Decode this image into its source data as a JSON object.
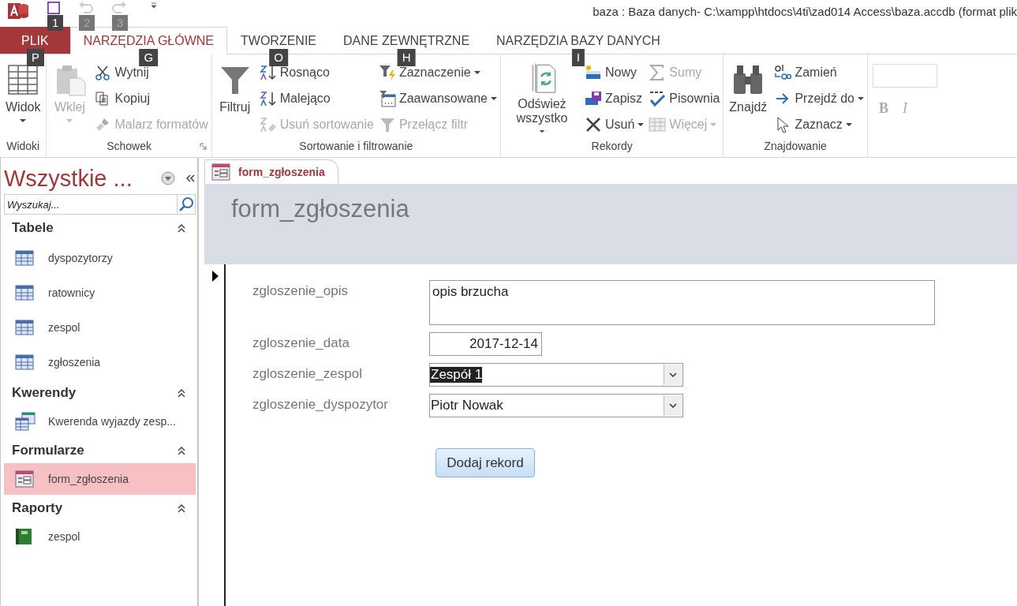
{
  "window": {
    "title": "baza : Baza danych- C:\\xampp\\htdocs\\4ti\\zad014 Access\\baza.accdb (format plik"
  },
  "quick_access": [
    {
      "keytip": "1",
      "disabled": false
    },
    {
      "keytip": "2",
      "disabled": true
    },
    {
      "keytip": "3",
      "disabled": true
    }
  ],
  "tabs": [
    {
      "label": "PLIK",
      "kind": "file",
      "keytip": "P",
      "selected": false
    },
    {
      "label": "NARZĘDZIA GŁÓWNE",
      "kind": "tab",
      "keytip": "G",
      "selected": true
    },
    {
      "label": "TWORZENIE",
      "kind": "tab",
      "keytip": "O",
      "selected": false
    },
    {
      "label": "DANE ZEWNĘTRZNE",
      "kind": "tab",
      "keytip": "H",
      "selected": false
    },
    {
      "label": "NARZĘDZIA BAZY DANYCH",
      "kind": "tab",
      "keytip": "I",
      "selected": false
    }
  ],
  "ribbon_groups": [
    {
      "label": "Widoki",
      "launcher": false,
      "items": [
        {
          "kind": "large",
          "label": "Widok",
          "disabled": false,
          "dropdown": true
        }
      ]
    },
    {
      "label": "Schowek",
      "launcher": true,
      "items": [
        {
          "kind": "large",
          "label": "Wklej",
          "disabled": true,
          "dropdown": true
        },
        {
          "kind": "column",
          "items": [
            {
              "label": "Wytnij",
              "disabled": false,
              "dropdown": false
            },
            {
              "label": "Kopiuj",
              "disabled": false,
              "dropdown": false
            },
            {
              "label": "Malarz formatów",
              "disabled": true,
              "dropdown": false
            }
          ]
        }
      ]
    },
    {
      "label": "Sortowanie i filtrowanie",
      "launcher": false,
      "items": [
        {
          "kind": "large",
          "label": "Filtruj",
          "disabled": false,
          "dropdown": false
        },
        {
          "kind": "column",
          "items": [
            {
              "label": "Rosnąco",
              "disabled": false,
              "dropdown": false
            },
            {
              "label": "Malejąco",
              "disabled": false,
              "dropdown": false
            },
            {
              "label": "Usuń sortowanie",
              "disabled": true,
              "dropdown": false
            }
          ]
        },
        {
          "kind": "column",
          "items": [
            {
              "label": "Zaznaczenie",
              "disabled": false,
              "dropdown": true
            },
            {
              "label": "Zaawansowane",
              "disabled": false,
              "dropdown": true
            },
            {
              "label": "Przełącz filtr",
              "disabled": true,
              "dropdown": false
            }
          ]
        }
      ]
    },
    {
      "label": "Rekordy",
      "launcher": false,
      "items": [
        {
          "kind": "large",
          "label": "Odśwież wszystko",
          "disabled": false,
          "dropdown": true
        },
        {
          "kind": "column",
          "items": [
            {
              "label": "Nowy",
              "disabled": false,
              "dropdown": false
            },
            {
              "label": "Zapisz",
              "disabled": false,
              "dropdown": false
            },
            {
              "label": "Usuń",
              "disabled": false,
              "dropdown": true
            }
          ]
        },
        {
          "kind": "column",
          "items": [
            {
              "label": "Sumy",
              "disabled": true,
              "dropdown": false
            },
            {
              "label": "Pisownia",
              "disabled": false,
              "dropdown": false
            },
            {
              "label": "Więcej",
              "disabled": true,
              "dropdown": true
            }
          ]
        }
      ]
    },
    {
      "label": "Znajdowanie",
      "launcher": false,
      "items": [
        {
          "kind": "large",
          "label": "Znajdź",
          "disabled": false,
          "dropdown": false
        },
        {
          "kind": "column",
          "items": [
            {
              "label": "Zamień",
              "disabled": false,
              "dropdown": false
            },
            {
              "label": "Przejdź do",
              "disabled": false,
              "dropdown": true
            },
            {
              "label": "Zaznacz",
              "disabled": false,
              "dropdown": true
            }
          ]
        }
      ]
    },
    {
      "kind": "format",
      "items": [
        {
          "kind": "font-field"
        },
        {
          "kind": "row",
          "items": [
            {
              "label": "B",
              "disabled": true
            },
            {
              "label": "I",
              "disabled": true
            }
          ]
        }
      ]
    }
  ],
  "navigation_pane": {
    "title": "Wszystkie ...",
    "search": {
      "placeholder": "Wyszukaj..."
    },
    "sections": [
      {
        "label": "Tabele",
        "expanded": true,
        "items": [
          {
            "label": "dyspozytorzy",
            "kind": "table",
            "selected": false
          },
          {
            "label": "ratownicy",
            "kind": "table",
            "selected": false
          },
          {
            "label": "zespol",
            "kind": "table",
            "selected": false
          },
          {
            "label": "zgłoszenia",
            "kind": "table",
            "selected": false
          }
        ]
      },
      {
        "label": "Kwerendy",
        "expanded": true,
        "items": [
          {
            "label": "Kwerenda wyjazdy zesp...",
            "kind": "query",
            "selected": false
          }
        ]
      },
      {
        "label": "Formularze",
        "expanded": true,
        "items": [
          {
            "label": "form_zgłoszenia",
            "kind": "form",
            "selected": true
          }
        ]
      },
      {
        "label": "Raporty",
        "expanded": true,
        "items": [
          {
            "label": "zespol",
            "kind": "report",
            "selected": false
          }
        ]
      }
    ]
  },
  "document_tabs": [
    {
      "label": "form_zgłoszenia",
      "selected": true
    }
  ],
  "form": {
    "title": "form_zgłoszenia",
    "fields": [
      {
        "label": "zgloszenie_opis",
        "kind": "memo",
        "value": "opis brzucha",
        "highlighted": false
      },
      {
        "label": "zgloszenie_data",
        "kind": "date",
        "value": "2017-12-14",
        "highlighted": false
      },
      {
        "label": "zgloszenie_zespol",
        "kind": "combo",
        "value": "Zespół 1",
        "highlighted": true
      },
      {
        "label": "zgloszenie_dyspozytor",
        "kind": "combo",
        "value": "Piotr Nowak",
        "highlighted": false
      }
    ],
    "button": "Dodaj rekord"
  }
}
